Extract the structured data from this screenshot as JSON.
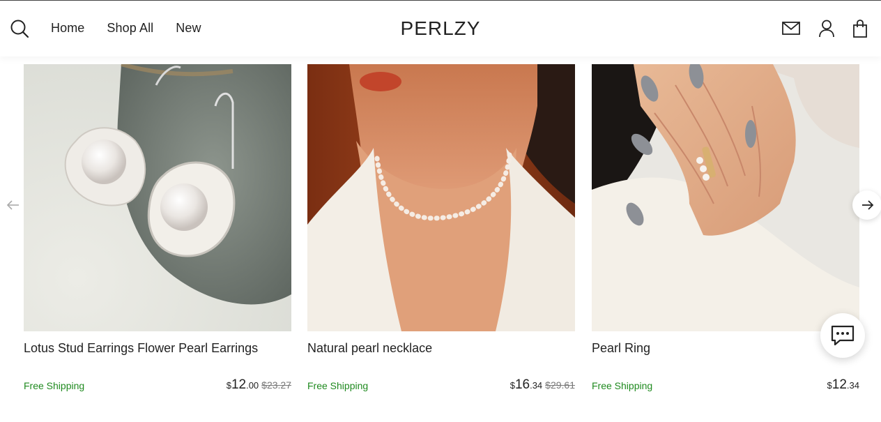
{
  "header": {
    "logo": "PERLZY",
    "nav": [
      {
        "label": "Home"
      },
      {
        "label": "Shop All"
      },
      {
        "label": "New"
      }
    ],
    "icons": [
      "search-icon",
      "mail-icon",
      "account-icon",
      "cart-icon"
    ]
  },
  "carousel": {
    "products": [
      {
        "title": "Lotus Stud Earrings Flower Pearl Earrings",
        "shipping": "Free Shipping",
        "currency": "$",
        "price_int": "12",
        "price_dec": ".00",
        "old_price": "$23.27"
      },
      {
        "title": "Natural pearl necklace",
        "shipping": "Free Shipping",
        "currency": "$",
        "price_int": "16",
        "price_dec": ".34",
        "old_price": "$29.61"
      },
      {
        "title": "Pearl Ring",
        "shipping": "Free Shipping",
        "currency": "$",
        "price_int": "12",
        "price_dec": ".34",
        "old_price": ""
      }
    ],
    "controls": [
      "arrow-left-icon",
      "arrow-right-icon"
    ]
  },
  "chat": {
    "icon": "chat-icon"
  },
  "colors": {
    "shipping_green": "#1f8a1f",
    "text": "#222222",
    "strike_gray": "#777777"
  }
}
